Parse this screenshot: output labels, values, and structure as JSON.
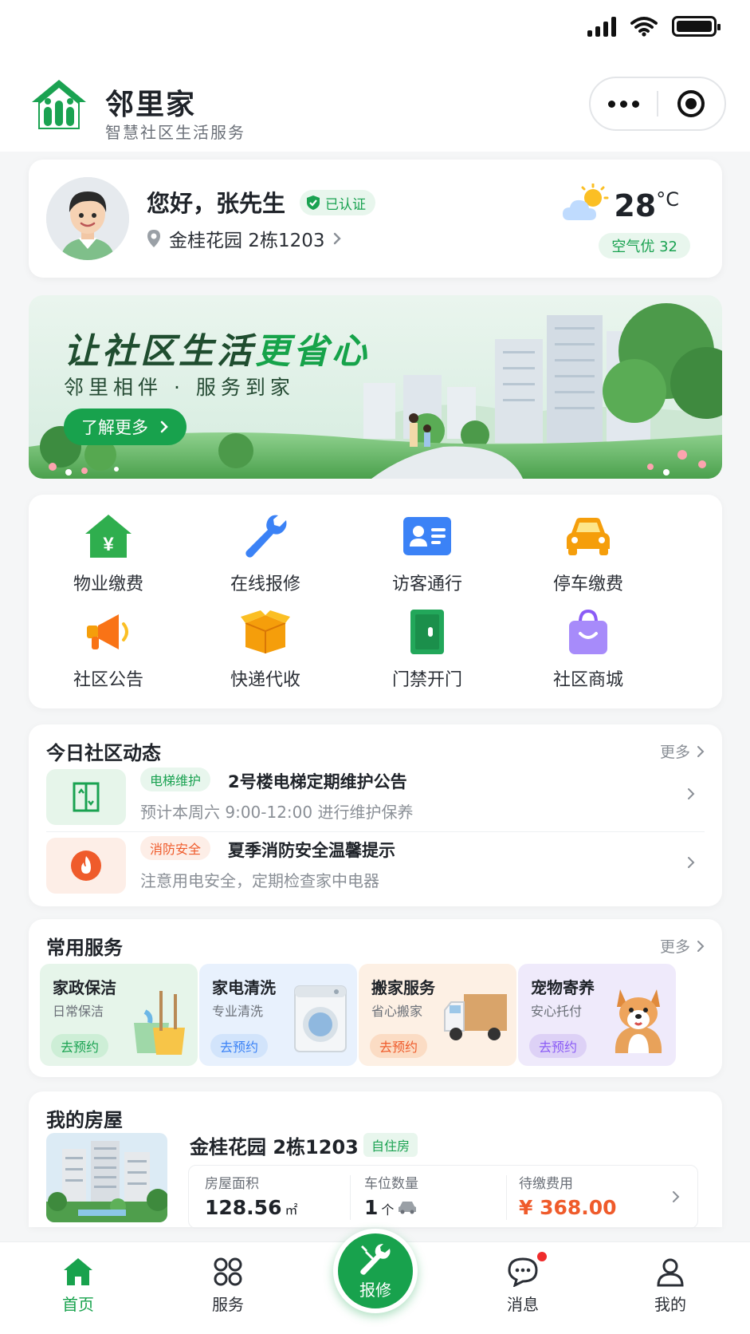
{
  "app": {
    "title": "邻里家",
    "subtitle": "智慧社区生活服务"
  },
  "user": {
    "greeting": "您好，张先生",
    "verified": "已认证",
    "address": "金桂花园 2栋1203"
  },
  "weather": {
    "temp": "28",
    "unit": "°C",
    "aqi": "空气优 32"
  },
  "banner": {
    "title_a": "让社区生活",
    "title_b": "更省心",
    "subtitle": "邻里相伴 · 服务到家",
    "button": "了解更多"
  },
  "grid": [
    {
      "label": "物业缴费",
      "icon": "property-fee-icon"
    },
    {
      "label": "在线报修",
      "icon": "wrench-icon"
    },
    {
      "label": "访客通行",
      "icon": "visitor-card-icon"
    },
    {
      "label": "停车缴费",
      "icon": "car-icon"
    },
    {
      "label": "社区公告",
      "icon": "megaphone-icon"
    },
    {
      "label": "快递代收",
      "icon": "package-icon"
    },
    {
      "label": "门禁开门",
      "icon": "door-icon"
    },
    {
      "label": "社区商城",
      "icon": "shopping-bag-icon"
    }
  ],
  "news": {
    "title": "今日社区动态",
    "more": "更多",
    "items": [
      {
        "tag": "电梯维护",
        "title": "2号楼电梯定期维护公告",
        "desc": "预计本周六 9:00-12:00 进行维护保养"
      },
      {
        "tag": "消防安全",
        "title": "夏季消防安全温馨提示",
        "desc": "注意用电安全，定期检查家中电器"
      }
    ]
  },
  "services": {
    "title": "常用服务",
    "more": "更多",
    "items": [
      {
        "title": "家政保洁",
        "sub": "日常保洁",
        "btn": "去预约"
      },
      {
        "title": "家电清洗",
        "sub": "专业清洗",
        "btn": "去预约"
      },
      {
        "title": "搬家服务",
        "sub": "省心搬家",
        "btn": "去预约"
      },
      {
        "title": "宠物寄养",
        "sub": "安心托付",
        "btn": "去预约"
      }
    ]
  },
  "house": {
    "title": "我的房屋",
    "name": "金桂花园  2栋1203",
    "tag": "自住房",
    "area_label": "房屋面积",
    "area_value": "128.56",
    "area_unit": "㎡",
    "parking_label": "车位数量",
    "parking_value": "1",
    "parking_unit": "个",
    "fee_label": "待缴费用",
    "fee_value": "¥ 368.00"
  },
  "tabs": {
    "home": "首页",
    "service": "服务",
    "repair": "报修",
    "message": "消息",
    "mine": "我的"
  },
  "colors": {
    "primary": "#18a24d",
    "warning": "#ef5b2b",
    "accent_orange": "#f59e0b",
    "accent_purple": "#8b5cf6"
  }
}
